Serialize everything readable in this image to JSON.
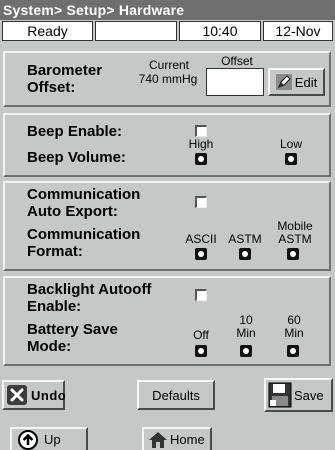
{
  "title": "System> Setup> Hardware",
  "status": {
    "state": "Ready",
    "middle": "",
    "time": "10:40",
    "date": "12-Nov"
  },
  "barometer": {
    "label": "Barometer Offset:",
    "current_label": "Current",
    "current_value": "740 mmHg",
    "offset_label": "Offset",
    "offset_value": "",
    "edit_label": "Edit"
  },
  "beep": {
    "enable_label": "Beep Enable:",
    "volume_label": "Beep Volume:",
    "high_label": "High",
    "low_label": "Low"
  },
  "communication": {
    "auto_export_label": "Communication Auto Export:",
    "format_label": "Communication Format:",
    "ascii_label": "ASCII",
    "astm_label": "ASTM",
    "mobile_astm_label": "Mobile ASTM"
  },
  "backlight": {
    "autooff_label": "Backlight Autooff Enable:",
    "battery_label": "Battery Save Mode:",
    "off_label": "Off",
    "ten_label": "10 Min",
    "sixty_label": "60 Min"
  },
  "toolbar": {
    "undo_label": "Undo",
    "defaults_label": "Defaults",
    "save_label": "Save"
  },
  "nav": {
    "up_label": "Up",
    "home_label": "Home"
  },
  "icons": {
    "undo": "close-x-icon",
    "edit": "pencil-icon",
    "save": "floppy-disk-icon",
    "up": "up-arrow-icon",
    "home": "home-icon"
  }
}
